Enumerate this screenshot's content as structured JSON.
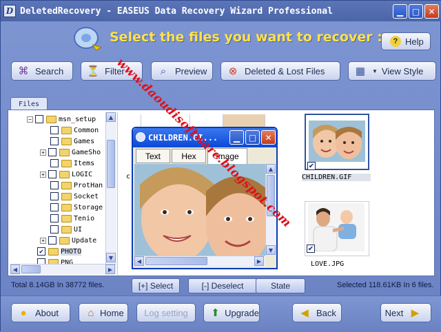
{
  "window": {
    "title": "DeletedRecovery - EASEUS Data Recovery Wizard Professional",
    "app_icon_letter": "D"
  },
  "header": {
    "headline": "Select the files you want to recover :",
    "help_label": "Help"
  },
  "toolbar": {
    "search_label": "Search",
    "filter_label": "Filter",
    "preview_label": "Preview",
    "deleted_lost_label": "Deleted & Lost Files",
    "view_style_label": "View Style"
  },
  "tree": {
    "tab_label": "Files",
    "items": [
      {
        "label": "msn_setup",
        "expander": "−",
        "checked": false
      },
      {
        "label": "Common",
        "expander": "",
        "checked": false
      },
      {
        "label": "Games",
        "expander": "",
        "checked": false
      },
      {
        "label": "GameSho",
        "expander": "+",
        "checked": false
      },
      {
        "label": "Items",
        "expander": "",
        "checked": false
      },
      {
        "label": "LOGIC",
        "expander": "+",
        "checked": false
      },
      {
        "label": "ProtHan",
        "expander": "",
        "checked": false
      },
      {
        "label": "Socket",
        "expander": "",
        "checked": false
      },
      {
        "label": "Storage",
        "expander": "",
        "checked": false
      },
      {
        "label": "Tenio",
        "expander": "",
        "checked": false
      },
      {
        "label": "UI",
        "expander": "",
        "checked": false
      },
      {
        "label": "Update",
        "expander": "+",
        "checked": false
      },
      {
        "label": "PHOTO",
        "expander": "",
        "checked": true
      },
      {
        "label": "PNG",
        "expander": "",
        "checked": false
      }
    ]
  },
  "thumbnails": {
    "partial_caption_letter": "c",
    "children": {
      "caption": "CHILDREN.GIF",
      "checked": true
    },
    "love": {
      "caption": "LOVE.JPG",
      "checked": true
    }
  },
  "preview_popup": {
    "title": "CHILDREN.GI...",
    "tabs": [
      "Text",
      "Hex",
      "Image"
    ]
  },
  "status": {
    "total": "Total 8.14GB In 38772 files.",
    "select_label": "[+] Select",
    "deselect_label": "[-] Deselect",
    "state_label": "State",
    "selected": "Selected 118.61KB In 6 files."
  },
  "footer": {
    "about_label": "About",
    "home_label": "Home",
    "log_setting_label": "Log setting",
    "upgrade_label": "Upgrade",
    "back_label": "Back",
    "next_label": "Next"
  },
  "watermark": "www.daoudisoftware.blogspot.com",
  "colors": {
    "headline": "#ffe24a",
    "window_bg": "#7e96d2",
    "watermark": "#e0101a"
  }
}
